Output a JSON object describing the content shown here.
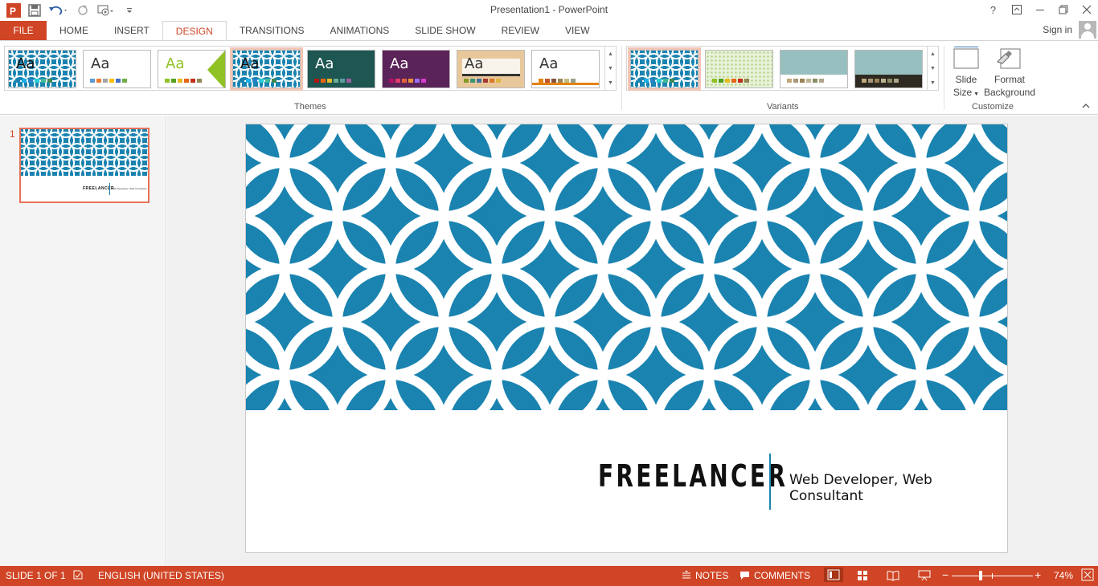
{
  "window": {
    "title": "Presentation1 - PowerPoint",
    "signin": "Sign in"
  },
  "tabs": [
    "FILE",
    "HOME",
    "INSERT",
    "DESIGN",
    "TRANSITIONS",
    "ANIMATIONS",
    "SLIDE SHOW",
    "REVIEW",
    "VIEW"
  ],
  "active_tab": "DESIGN",
  "ribbon": {
    "themes_label": "Themes",
    "variants_label": "Variants",
    "customize_label": "Customize",
    "theme_thumb_text": "Aa",
    "slide_size_label": "Slide Size",
    "slide_size_line1": "Slide",
    "slide_size_line2": "Size",
    "format_bg_line1": "Format",
    "format_bg_line2": "Background"
  },
  "themes": [
    {
      "name": "theme-current",
      "bg": "pattern",
      "text_color": "#111111",
      "swatches": [
        "#1A83B0",
        "#1CADE4",
        "#2683C6",
        "#27CED7",
        "#42BA97",
        "#3E8853"
      ]
    },
    {
      "name": "theme-office",
      "bg": "#ffffff",
      "text_color": "#333333",
      "swatches": [
        "#5B9BD5",
        "#ED7D31",
        "#A5A5A5",
        "#FFC000",
        "#4472C4",
        "#70AD47"
      ]
    },
    {
      "name": "theme-facet",
      "bg": "#ffffff",
      "text_color": "#90C226",
      "swatches": [
        "#90C226",
        "#54A021",
        "#E6B91E",
        "#E76618",
        "#C42F1A",
        "#918655"
      ]
    },
    {
      "name": "theme-integral",
      "bg": "pattern",
      "text_color": "#111111",
      "swatches": [
        "#1A83B0",
        "#1CADE4",
        "#2683C6",
        "#27CED7",
        "#42BA97",
        "#3E8853"
      ]
    },
    {
      "name": "theme-ion-boardroom",
      "bg": "#1E5652",
      "text_color": "#ffffff",
      "swatches": [
        "#B01513",
        "#EA6312",
        "#E6B729",
        "#6AAC90",
        "#5F9C9D",
        "#9E5E9B"
      ]
    },
    {
      "name": "theme-ion",
      "bg": "#5B2458",
      "text_color": "#ffffff",
      "swatches": [
        "#B31166",
        "#E33D6F",
        "#E45F3C",
        "#E9943A",
        "#9B6BF2",
        "#D53DD0"
      ]
    },
    {
      "name": "theme-organic",
      "bg": "#E8C89A",
      "text_color": "#333333",
      "swatches": [
        "#83992A",
        "#3C9770",
        "#44709D",
        "#A23C33",
        "#D97828",
        "#DEB340"
      ]
    },
    {
      "name": "theme-retrospect",
      "bg": "#ffffff",
      "text_color": "#333333",
      "swatches": [
        "#E48312",
        "#BD582C",
        "#865640",
        "#9B8357",
        "#C2BC80",
        "#94A088"
      ]
    }
  ],
  "variants": [
    {
      "name": "variant-blue-pattern",
      "bg": "pattern",
      "swatches": [
        "#1A83B0",
        "#1CADE4",
        "#2683C6",
        "#27CED7",
        "#42BA97",
        "#3E8853"
      ]
    },
    {
      "name": "variant-green-pattern",
      "bg": "pattern-green",
      "swatches": [
        "#90C226",
        "#54A021",
        "#E6B91E",
        "#E76618",
        "#C42F1A",
        "#918655"
      ]
    },
    {
      "name": "variant-teal",
      "bg": "#97BFC0",
      "swatches": [
        "#C0A97B",
        "#A8987A",
        "#9B8357",
        "#BDB38F",
        "#8C8C66",
        "#AFA58A"
      ]
    },
    {
      "name": "variant-dark-teal",
      "bg": "#97BFC0",
      "swatches": [
        "#C0A97B",
        "#A8987A",
        "#9B8357",
        "#BDB38F",
        "#8C8C66",
        "#AFA58A"
      ]
    }
  ],
  "slides_pane": {
    "slide_number": "1",
    "thumb_title": "FREELANCER",
    "thumb_subtitle": "Web Developer, Web Consultant"
  },
  "slide": {
    "title": "FREELANCER",
    "subtitle": "Web Developer, Web Consultant",
    "accent_color": "#1A83B0"
  },
  "status": {
    "slide_info": "SLIDE 1 OF 1",
    "language": "ENGLISH (UNITED STATES)",
    "notes": "NOTES",
    "comments": "COMMENTS",
    "zoom": "74%",
    "zoom_minus": "−",
    "zoom_plus": "+",
    "zoom_level": 0.74,
    "bar_color": "#D04525"
  }
}
